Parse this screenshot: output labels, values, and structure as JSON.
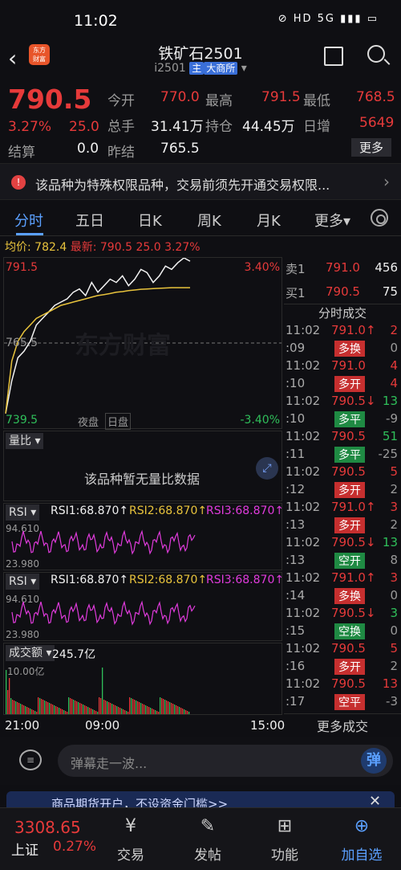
{
  "status": {
    "time": "11:02",
    "icons": "⊘ HD 5G ▮▮▮ ▭"
  },
  "header": {
    "logo_line1": "东方",
    "logo_line2": "财富",
    "title": "铁矿石2501",
    "code": "i2501",
    "tag_main": "主",
    "tag_exchange": "大商所"
  },
  "quote": {
    "price": "790.5",
    "pct": "3.27%",
    "change": "25.0",
    "open_label": "今开",
    "open": "770.0",
    "high_label": "最高",
    "high": "791.5",
    "low_label": "最低",
    "low": "768.5",
    "vol_label": "总手",
    "vol": "31.41万",
    "oi_label": "持仓",
    "oi": "44.45万",
    "inc_label": "日增",
    "inc": "5649",
    "settle_label": "结算",
    "settle": "0.0",
    "prev_label": "昨结",
    "prev": "765.5",
    "more": "更多"
  },
  "notice": {
    "icon": "!",
    "text": "该品种为特殊权限品种，交易前须先开通交易权限...",
    "arrow": "›"
  },
  "tabs": [
    "分时",
    "五日",
    "日K",
    "周K",
    "月K",
    "更多▾"
  ],
  "avg": {
    "avg_label": "均价:",
    "avg": "782.4",
    "latest_label": "最新:",
    "latest": "790.5",
    "chg": "25.0",
    "pct": "3.27%"
  },
  "chart": {
    "top_price": "791.5",
    "top_pct": "3.40%",
    "mid_price": "765.5",
    "bot_price": "739.5",
    "bot_pct": "-3.40%",
    "night": "夜盘",
    "day": "日盘",
    "watermark": "东方财富",
    "x_start": "21:00",
    "x_mid": "09:00",
    "x_end": "15:00"
  },
  "chart_data": {
    "type": "line",
    "title": "",
    "series": [
      {
        "name": "最新",
        "values": [
          744,
          754,
          761,
          763,
          766,
          771,
          773,
          775,
          777,
          778,
          779,
          781,
          782,
          780,
          784,
          781,
          783,
          785,
          784,
          786,
          783,
          785,
          788,
          787,
          784,
          786,
          789,
          788,
          790,
          791.5,
          790.5
        ]
      },
      {
        "name": "均价",
        "values": [
          744,
          760,
          766,
          769,
          771,
          773,
          774,
          775,
          776,
          777,
          777.5,
          778,
          778.5,
          779,
          779.5,
          780,
          780.3,
          780.6,
          781,
          781.2,
          781.5,
          781.7,
          781.9,
          782,
          782.1,
          782.2,
          782.3,
          782.4,
          782.4,
          782.4,
          782.4
        ]
      }
    ],
    "ylim": [
      739.5,
      791.5
    ]
  },
  "volratio": {
    "label": "量比",
    "empty": "该品种暂无量比数据"
  },
  "rsi": {
    "label": "RSI",
    "r1": "RSI1:68.870↑",
    "r2": "RSI2:68.870↑",
    "r3": "RSI3:68.870↑",
    "hi": "94.610",
    "lo": "23.980"
  },
  "turnover": {
    "label": "成交额",
    "value": "245.7亿",
    "scale": "10.00亿"
  },
  "book": {
    "sell_label": "卖1",
    "sell_price": "791.0",
    "sell_vol": "456",
    "buy_label": "买1",
    "buy_price": "790.5",
    "buy_vol": "75",
    "title": "分时成交",
    "more": "更多成交",
    "trades": [
      {
        "t": "11:02",
        "p": "791.0↑",
        "v": "2",
        "pc": "red",
        "vc": "red"
      },
      {
        "t": ":09",
        "p": "多换",
        "v": "0",
        "pc": "tagred",
        "vc": "gray"
      },
      {
        "t": "11:02",
        "p": "791.0",
        "v": "4",
        "pc": "red",
        "vc": "red"
      },
      {
        "t": ":10",
        "p": "多开",
        "v": "4",
        "pc": "tagred",
        "vc": "red"
      },
      {
        "t": "11:02",
        "p": "790.5↓",
        "v": "13",
        "pc": "red",
        "vc": "green"
      },
      {
        "t": ":10",
        "p": "多平",
        "v": "-9",
        "pc": "taggreen",
        "vc": "gray"
      },
      {
        "t": "11:02",
        "p": "790.5",
        "v": "51",
        "pc": "red",
        "vc": "green"
      },
      {
        "t": ":11",
        "p": "多平",
        "v": "-25",
        "pc": "taggreen",
        "vc": "gray"
      },
      {
        "t": "11:02",
        "p": "790.5",
        "v": "5",
        "pc": "red",
        "vc": "red"
      },
      {
        "t": ":12",
        "p": "多开",
        "v": "2",
        "pc": "tagred",
        "vc": "gray"
      },
      {
        "t": "11:02",
        "p": "791.0↑",
        "v": "3",
        "pc": "red",
        "vc": "red"
      },
      {
        "t": ":13",
        "p": "多开",
        "v": "2",
        "pc": "tagred",
        "vc": "gray"
      },
      {
        "t": "11:02",
        "p": "790.5↓",
        "v": "13",
        "pc": "red",
        "vc": "green"
      },
      {
        "t": ":13",
        "p": "空开",
        "v": "8",
        "pc": "taggreen",
        "vc": "gray"
      },
      {
        "t": "11:02",
        "p": "791.0↑",
        "v": "3",
        "pc": "red",
        "vc": "red"
      },
      {
        "t": ":14",
        "p": "多换",
        "v": "0",
        "pc": "tagred",
        "vc": "gray"
      },
      {
        "t": "11:02",
        "p": "790.5↓",
        "v": "3",
        "pc": "red",
        "vc": "green"
      },
      {
        "t": ":15",
        "p": "空换",
        "v": "0",
        "pc": "taggreen",
        "vc": "gray"
      },
      {
        "t": "11:02",
        "p": "790.5",
        "v": "5",
        "pc": "red",
        "vc": "red"
      },
      {
        "t": ":16",
        "p": "多开",
        "v": "2",
        "pc": "tagred",
        "vc": "gray"
      },
      {
        "t": "11:02",
        "p": "790.5",
        "v": "13",
        "pc": "red",
        "vc": "red"
      },
      {
        "t": ":17",
        "p": "空平",
        "v": "-3",
        "pc": "tagred",
        "vc": "gray"
      }
    ]
  },
  "comment": {
    "placeholder": "弹幕走一波...",
    "danmu": "弹"
  },
  "banner": {
    "text": "商品期货开户，不设资金门槛>>"
  },
  "index": {
    "value": "3308.65",
    "name": "上证",
    "pct": "0.27%"
  },
  "nav": [
    {
      "icon": "¥",
      "label": "交易"
    },
    {
      "icon": "✎",
      "label": "发帖"
    },
    {
      "icon": "⊞",
      "label": "功能"
    },
    {
      "icon": "⊕",
      "label": "加自选"
    }
  ]
}
